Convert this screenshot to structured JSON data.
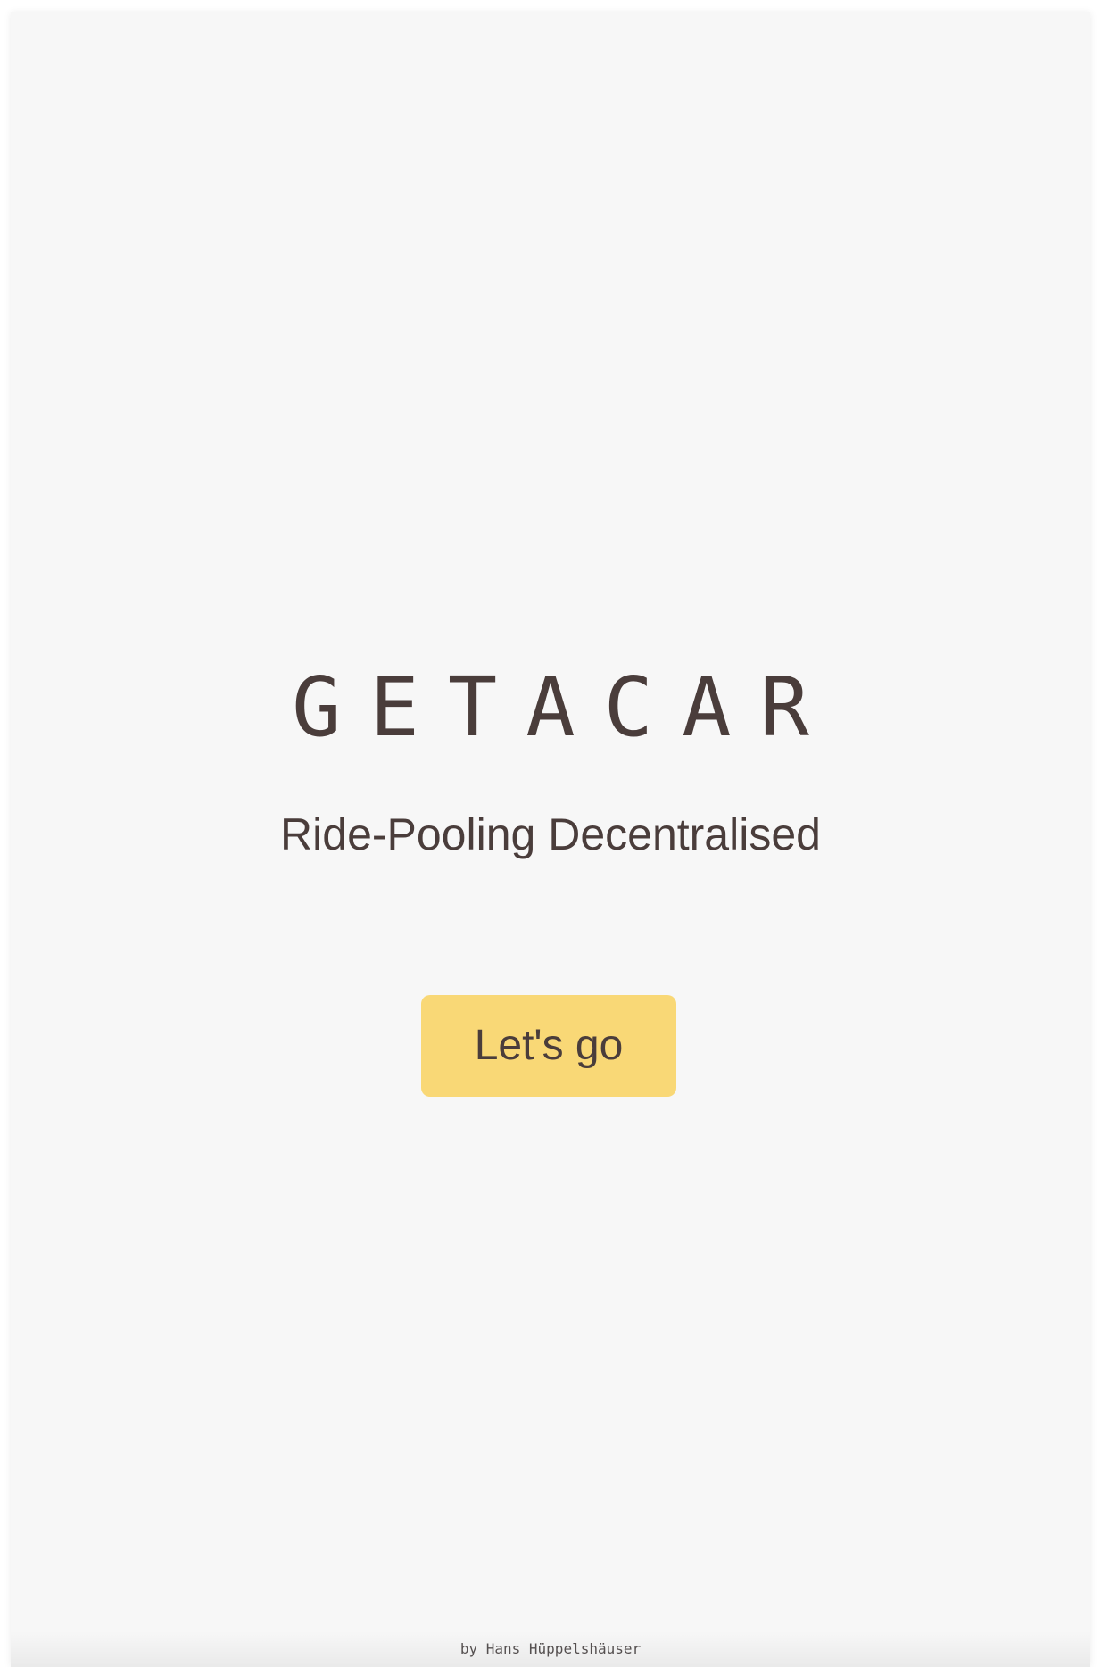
{
  "app": {
    "logo_text": "GETACAR",
    "tagline": "Ride-Pooling Decentralised"
  },
  "actions": {
    "start_label": "Let's go"
  },
  "footer": {
    "credit": "by Hans Hüppelshäuser"
  },
  "colors": {
    "background": "#f7f7f7",
    "text": "#4a3d3b",
    "accent": "#f9d876"
  }
}
